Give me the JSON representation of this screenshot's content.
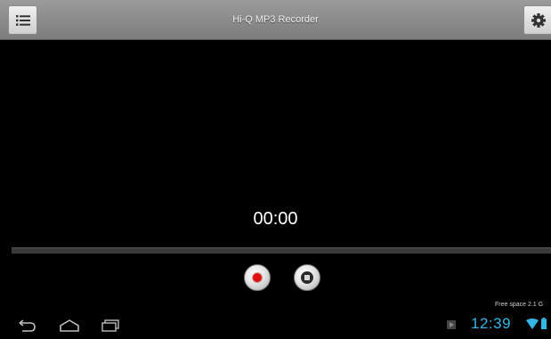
{
  "app": {
    "title": "Hi-Q MP3 Recorder"
  },
  "action_bar": {
    "menu_icon": "list-icon",
    "settings_icon": "gear-icon"
  },
  "recorder": {
    "elapsed": "00:00",
    "progress_fraction": 0,
    "free_space": "Free space 2.1 G",
    "controls": {
      "record_icon": "record-icon",
      "stop_icon": "stop-icon"
    }
  },
  "system_bar": {
    "clock": "12:39",
    "nav": [
      "back-icon",
      "home-icon",
      "recent-apps-icon"
    ],
    "status_icons": [
      "notification-icon",
      "wifi-icon",
      "battery-icon"
    ]
  },
  "colors": {
    "accent_clock": "#33b5e5",
    "record_red": "#e01010",
    "background": "#000000"
  }
}
